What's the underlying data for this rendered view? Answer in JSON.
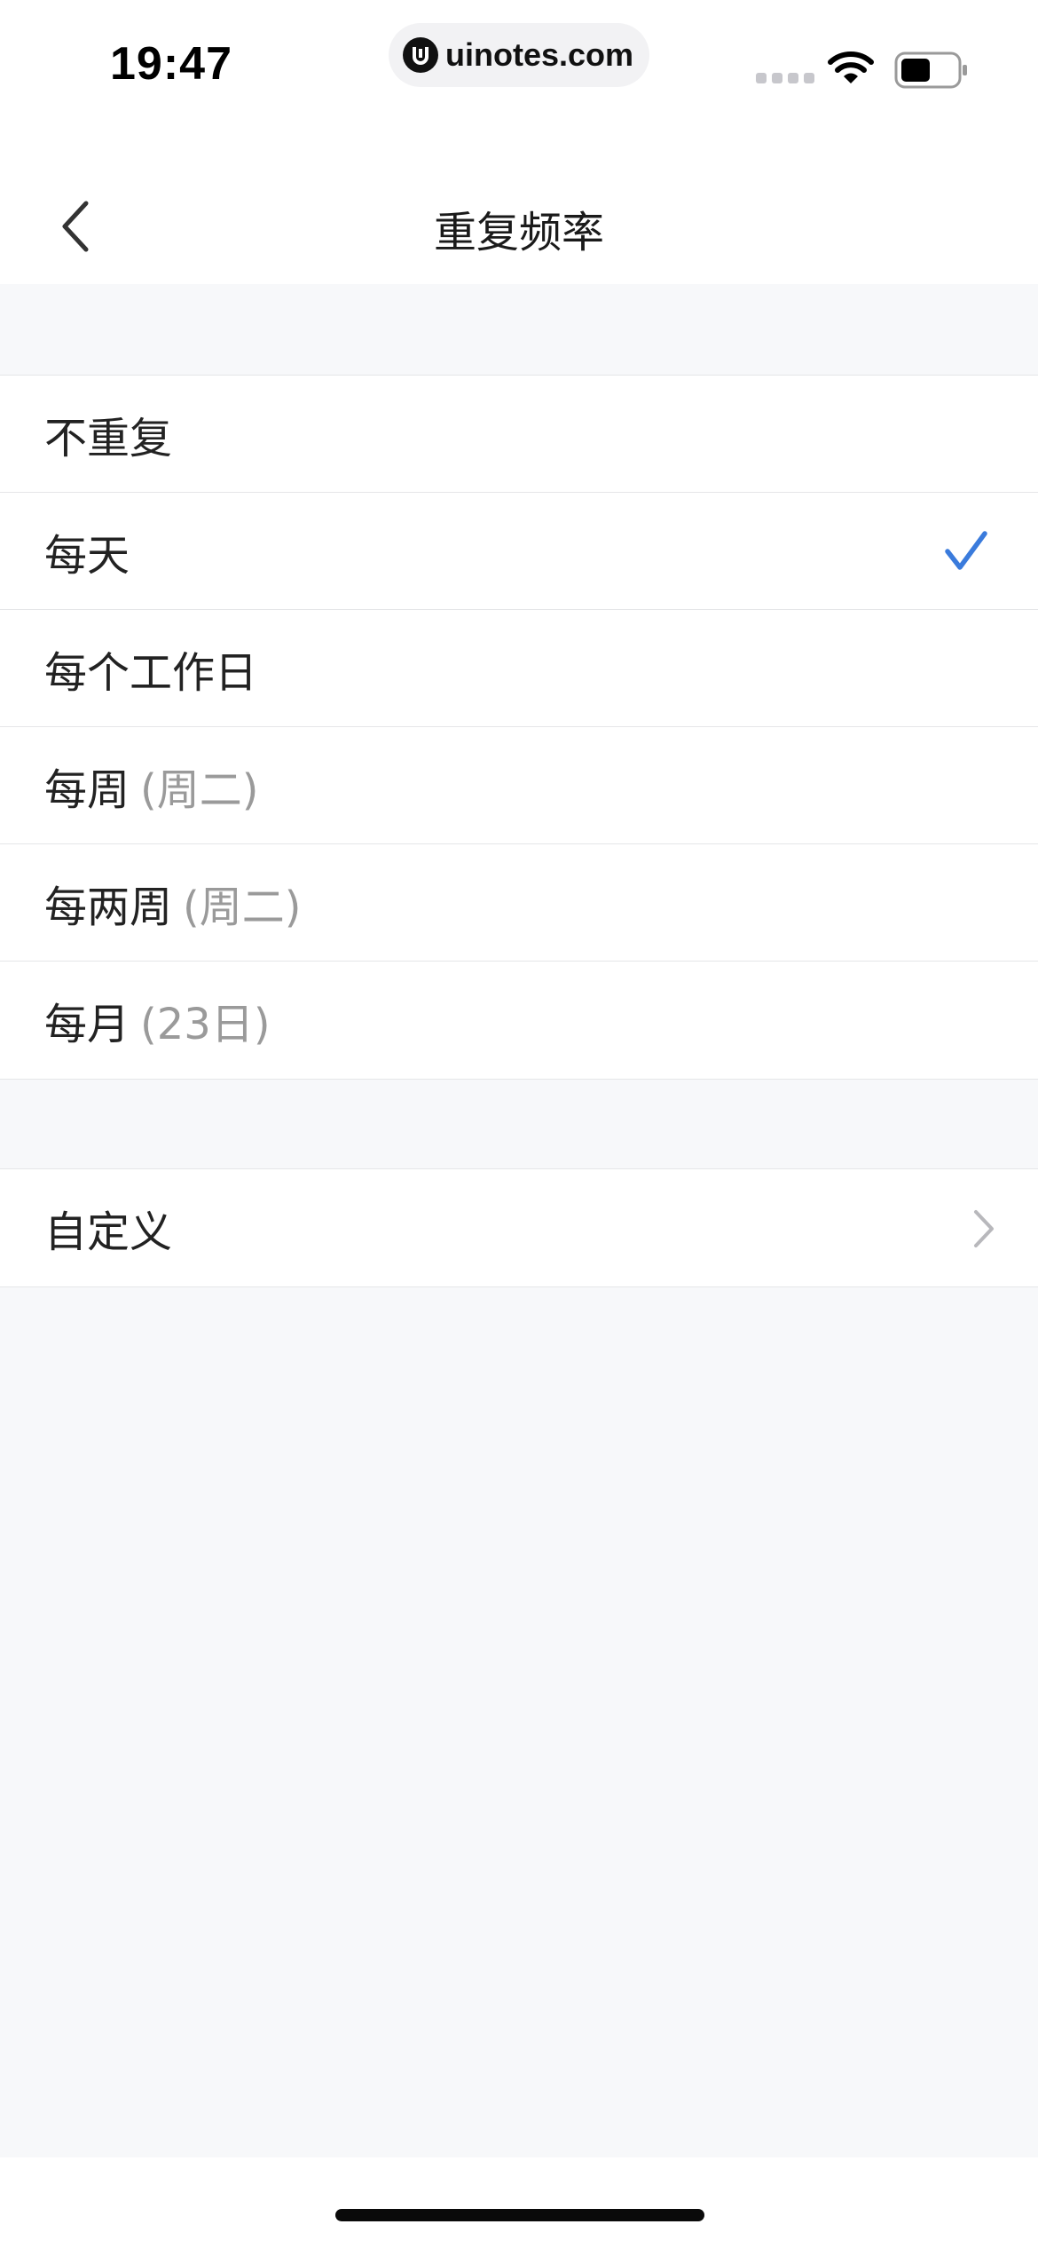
{
  "status_bar": {
    "time": "19:47",
    "url": "uinotes.com",
    "icons": [
      "signal-icon",
      "wifi-icon",
      "battery-icon"
    ]
  },
  "nav": {
    "title": "重复频率",
    "back_icon": "chevron-left-icon"
  },
  "options": [
    {
      "label": "不重复",
      "hint": "",
      "selected": false
    },
    {
      "label": "每天",
      "hint": "",
      "selected": true
    },
    {
      "label": "每个工作日",
      "hint": "",
      "selected": false
    },
    {
      "label": "每周",
      "hint": "(周二)",
      "selected": false
    },
    {
      "label": "每两周",
      "hint": "(周二)",
      "selected": false
    },
    {
      "label": "每月",
      "hint": "(23日)",
      "selected": false
    }
  ],
  "custom": {
    "label": "自定义",
    "icon": "chevron-right-icon"
  },
  "colors": {
    "accent": "#3a7bdc",
    "background": "#f7f8fa",
    "hint_text": "#9a9a9a"
  }
}
